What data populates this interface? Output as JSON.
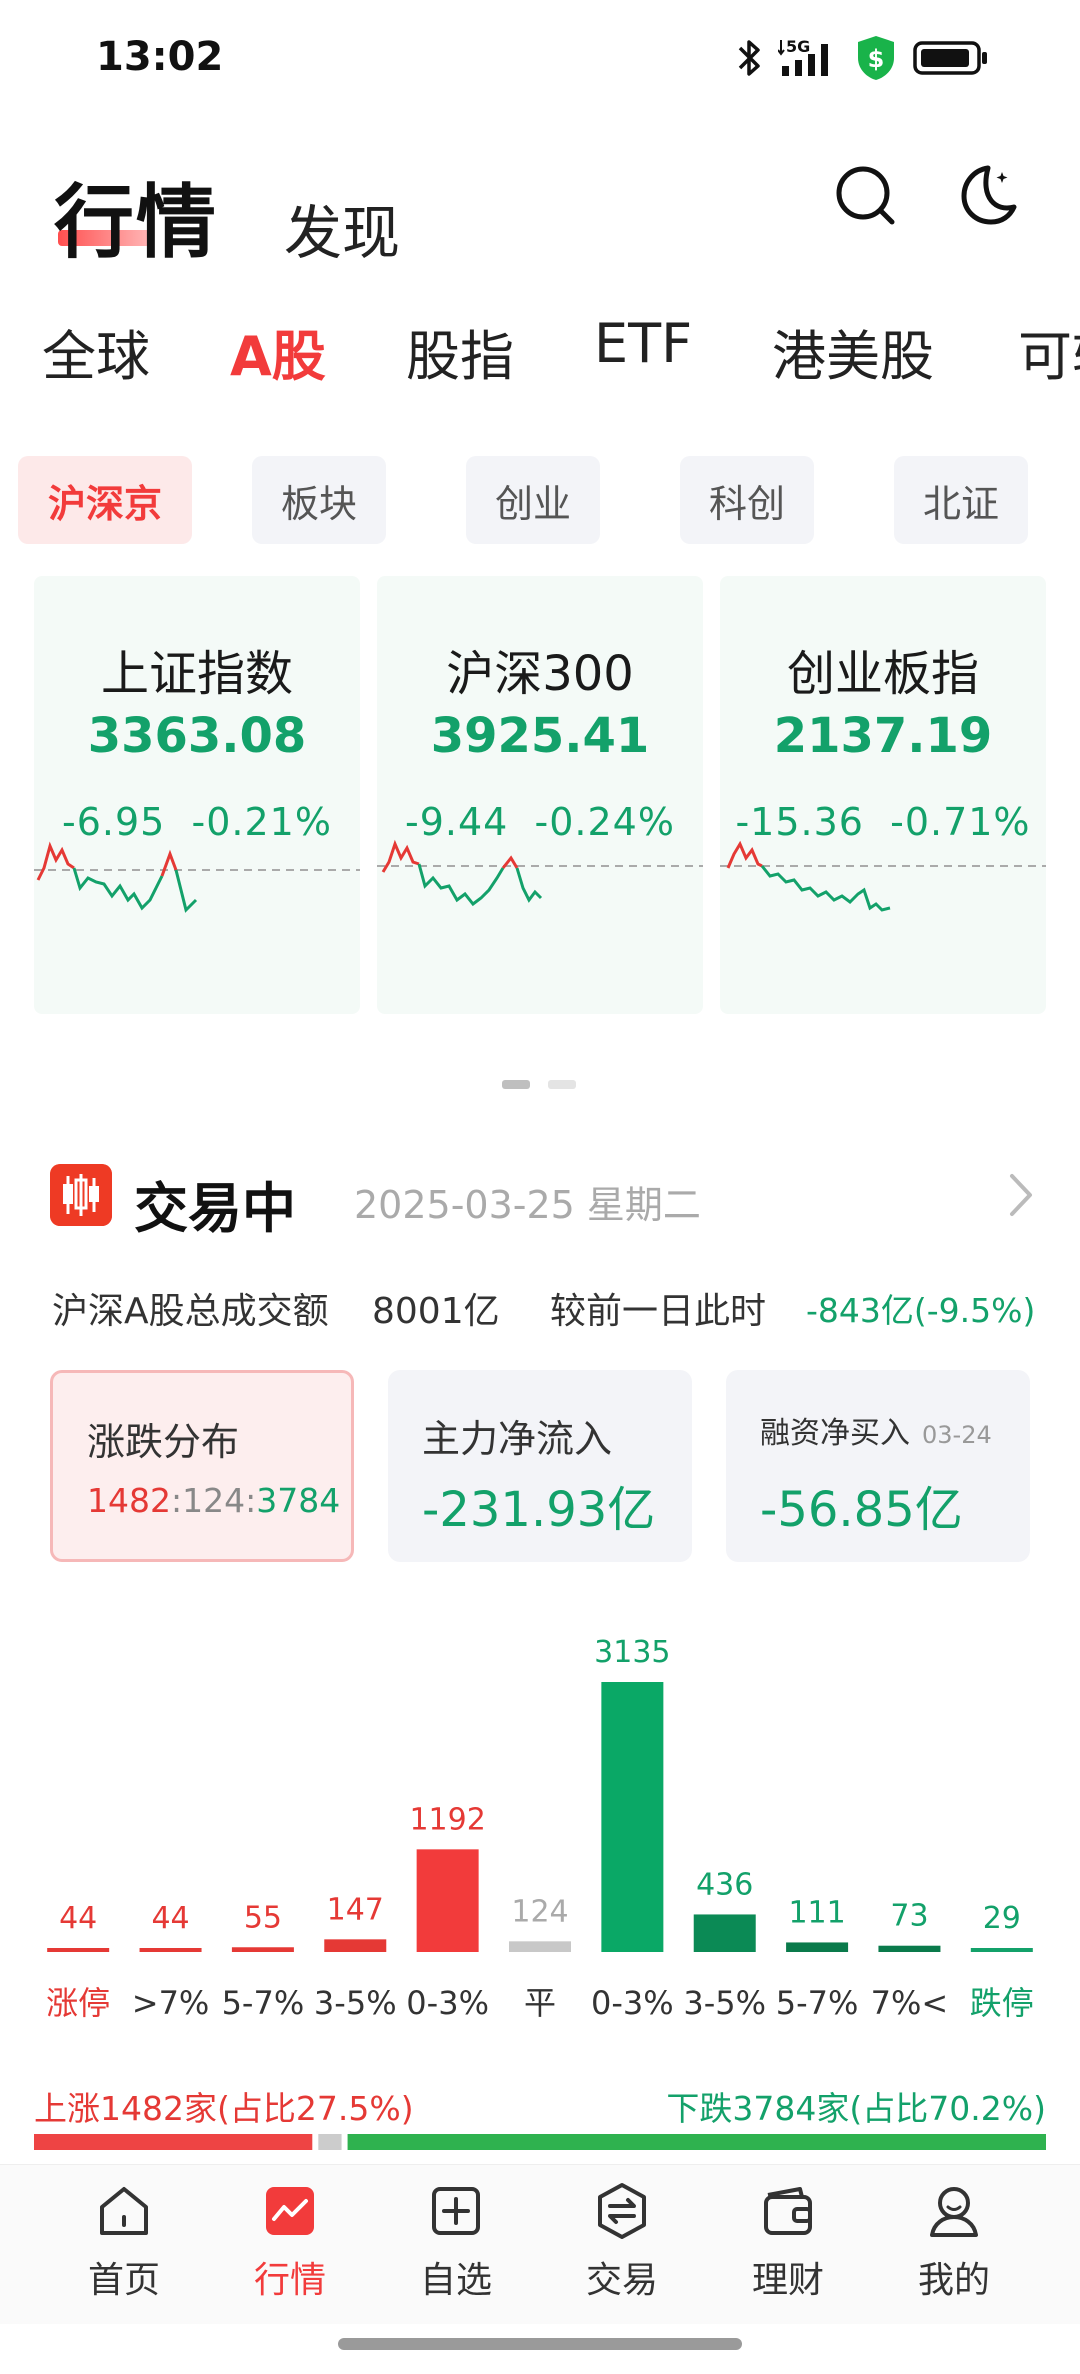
{
  "status": {
    "time": "13:02",
    "network": "5G"
  },
  "header": {
    "title": "行情",
    "subtitle": "发现"
  },
  "tabs": [
    "全球",
    "A股",
    "股指",
    "ETF",
    "港美股",
    "可转"
  ],
  "subtabs": [
    "沪深京",
    "板块",
    "创业",
    "科创",
    "北证"
  ],
  "indices": [
    {
      "name": "上证指数",
      "value": "3363.08",
      "change": "-6.95",
      "pct": "-0.21%"
    },
    {
      "name": "沪深300",
      "value": "3925.41",
      "change": "-9.44",
      "pct": "-0.24%"
    },
    {
      "name": "创业板指",
      "value": "2137.19",
      "change": "-15.36",
      "pct": "-0.71%"
    }
  ],
  "trading": {
    "title": "交易中",
    "date": "2025-03-25 星期二",
    "volume_label": "沪深A股总成交额",
    "volume_value": "8001亿",
    "compare_label": "较前一日此时",
    "compare_value": "-843亿(-9.5%)"
  },
  "stats": {
    "dist": {
      "title": "涨跌分布",
      "up": "1482",
      "flat": "124",
      "down": "3784"
    },
    "main_flow": {
      "title": "主力净流入",
      "value": "-231.93亿"
    },
    "margin": {
      "title": "融资净买入",
      "date": "03-24",
      "value": "-56.85亿"
    }
  },
  "chart_data": {
    "type": "bar",
    "categories": [
      "涨停",
      ">7%",
      "5-7%",
      "3-5%",
      "0-3%",
      "平",
      "0-3%",
      "3-5%",
      "5-7%",
      "7%<",
      "跌停"
    ],
    "values": [
      44,
      44,
      55,
      147,
      1192,
      124,
      3135,
      436,
      111,
      73,
      29
    ],
    "colors": [
      "#e53935",
      "#e53935",
      "#e53935",
      "#e53935",
      "#f23b3b",
      "#c8c8c8",
      "#0aa866",
      "#0b8a55",
      "#0a7a4b",
      "#0a7a4b",
      "#13a16a"
    ]
  },
  "proportion": {
    "up_text": "上涨1482家(占比27.5%)",
    "down_text": "下跌3784家(占比70.2%)",
    "up_ratio": 0.275,
    "flat_ratio": 0.023,
    "down_ratio": 0.702
  },
  "nav": [
    {
      "label": "首页",
      "icon": "home-icon"
    },
    {
      "label": "行情",
      "icon": "market-icon"
    },
    {
      "label": "自选",
      "icon": "add-watchlist-icon"
    },
    {
      "label": "交易",
      "icon": "trade-icon"
    },
    {
      "label": "理财",
      "icon": "wallet-icon"
    },
    {
      "label": "我的",
      "icon": "profile-icon"
    }
  ],
  "colors": {
    "up": "#e53935",
    "down": "#13a16a",
    "accent": "#f23b3b"
  }
}
